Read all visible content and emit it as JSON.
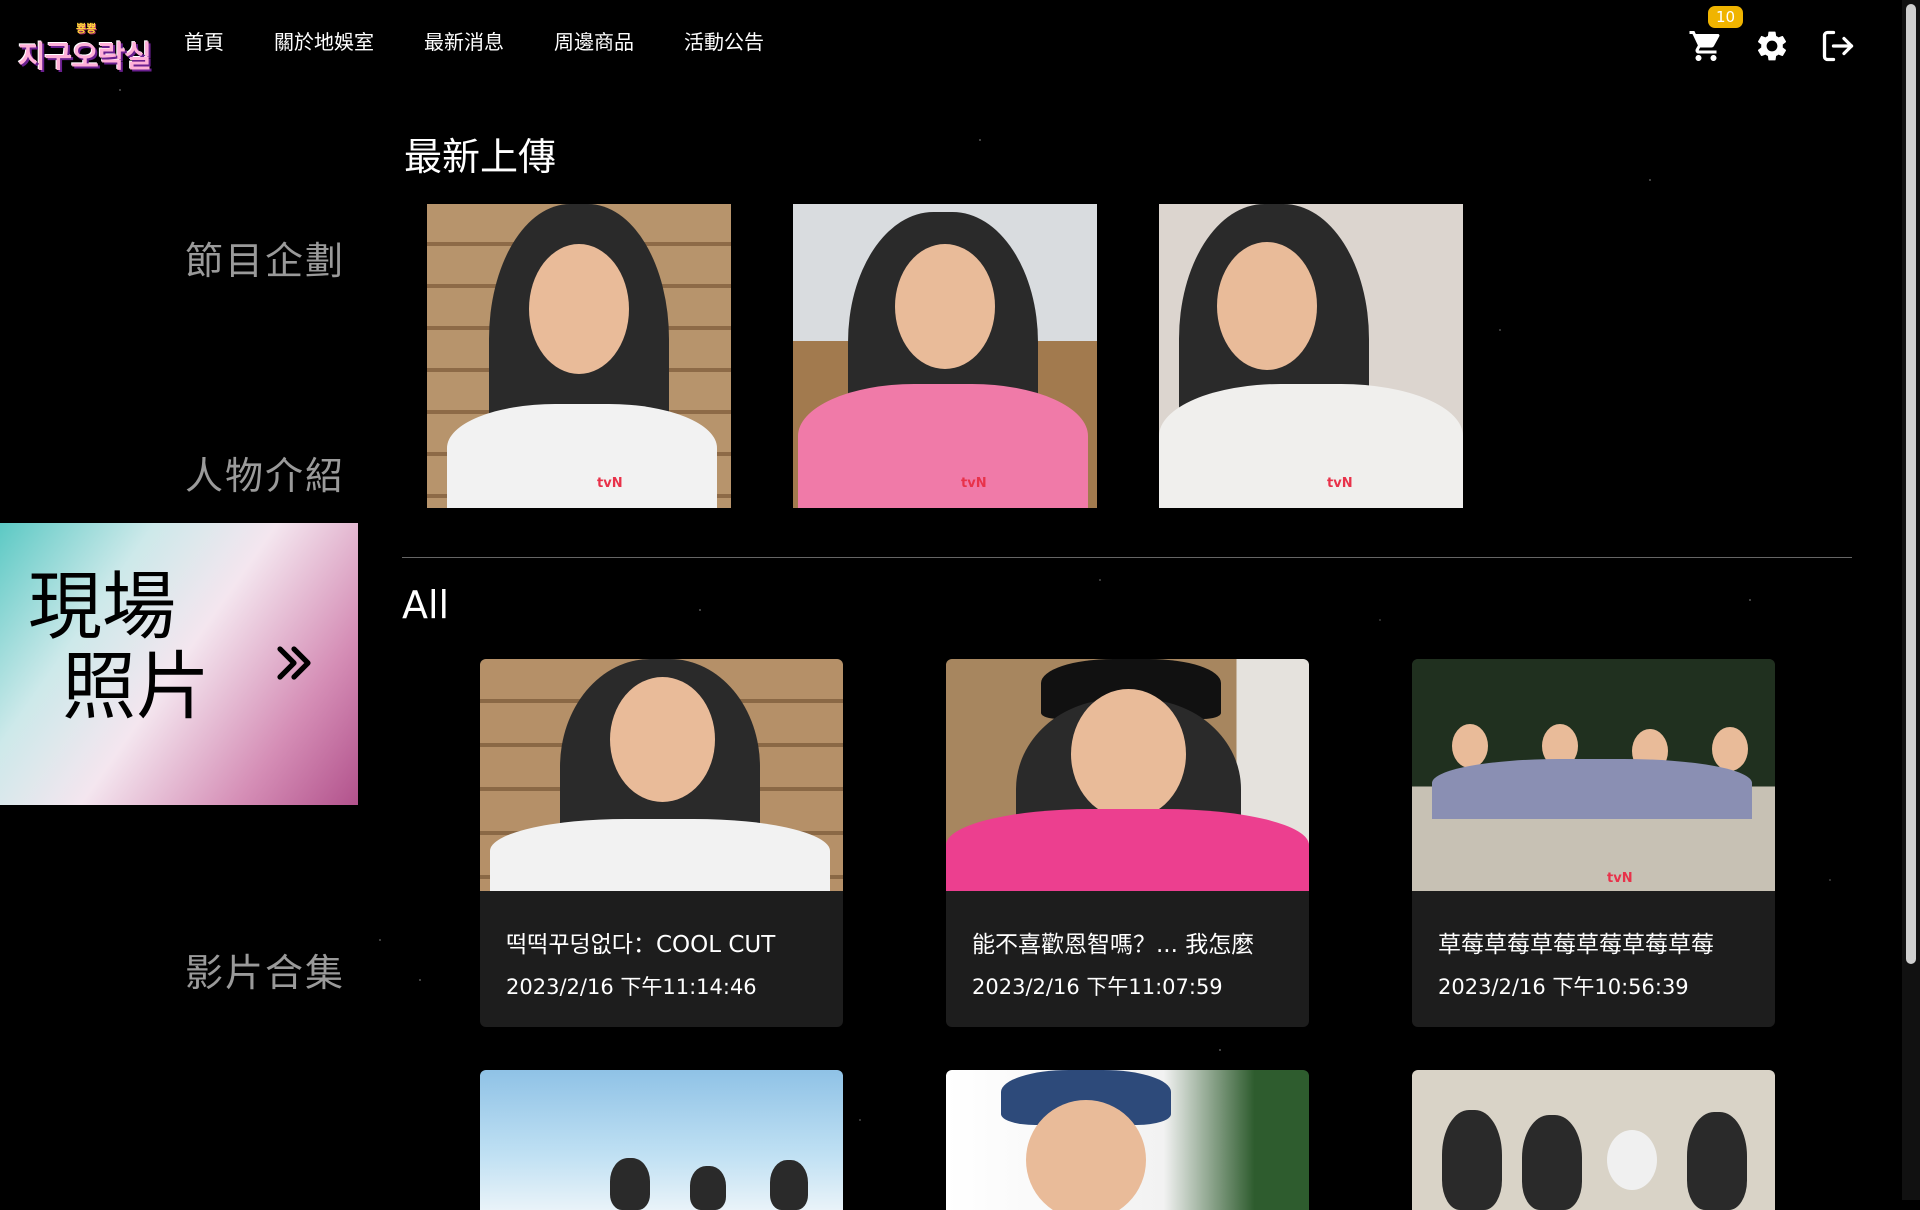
{
  "brand": {
    "logo_top": "뿅뿅",
    "logo_main": "지구오락실"
  },
  "nav": [
    "首頁",
    "關於地娛室",
    "最新消息",
    "周邊商品",
    "活動公告"
  ],
  "header_icons": {
    "cart_count": "10"
  },
  "sidebar": {
    "items": [
      "節目企劃",
      "人物介紹",
      "影片合集"
    ],
    "active_line1": "現場",
    "active_line2": "照片"
  },
  "latest": {
    "title": "最新上傳"
  },
  "all": {
    "title": "All",
    "cards": [
      {
        "title": "떡떡꾸덩없다：COOL CUT",
        "date": "2023/2/16 下午11:14:46"
      },
      {
        "title": "能不喜歡恩智嗎？... 我怎麼",
        "date": "2023/2/16 下午11:07:59"
      },
      {
        "title": "草莓草莓草莓草莓草莓草莓",
        "date": "2023/2/16 下午10:56:39"
      }
    ]
  },
  "watermark": {
    "show": "지구오락실",
    "channel": "tvN"
  }
}
